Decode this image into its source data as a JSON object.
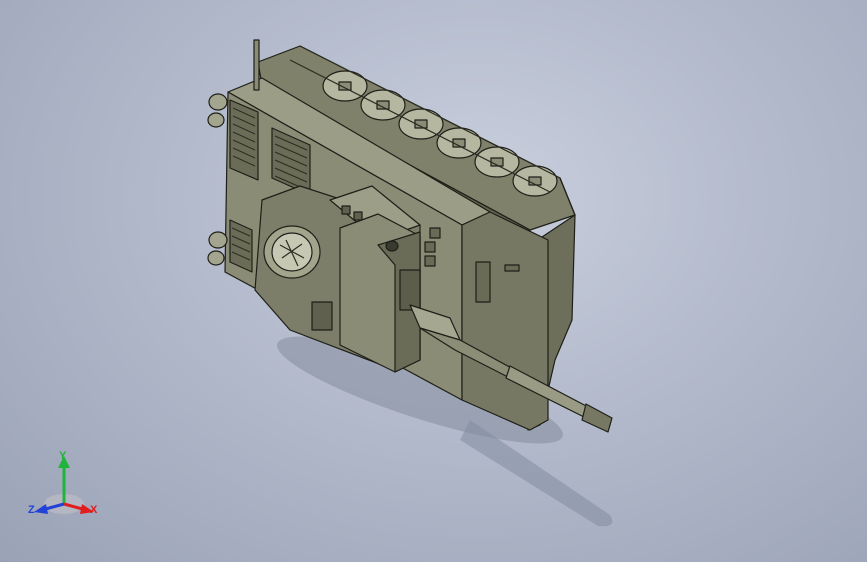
{
  "viewport": {
    "background_top": "#c9cfdd",
    "background_bottom": "#9aa2b6"
  },
  "model": {
    "hull_color": "#8b8c76",
    "hull_dark": "#5d5e4c",
    "hull_light": "#a9aa92",
    "edge_color": "#1e1f18",
    "wheel_count": 6
  },
  "triad": {
    "x_label": "X",
    "y_label": "Y",
    "z_label": "Z",
    "x_color": "#e01e1e",
    "y_color": "#1fb53a",
    "z_color": "#2342d8"
  }
}
